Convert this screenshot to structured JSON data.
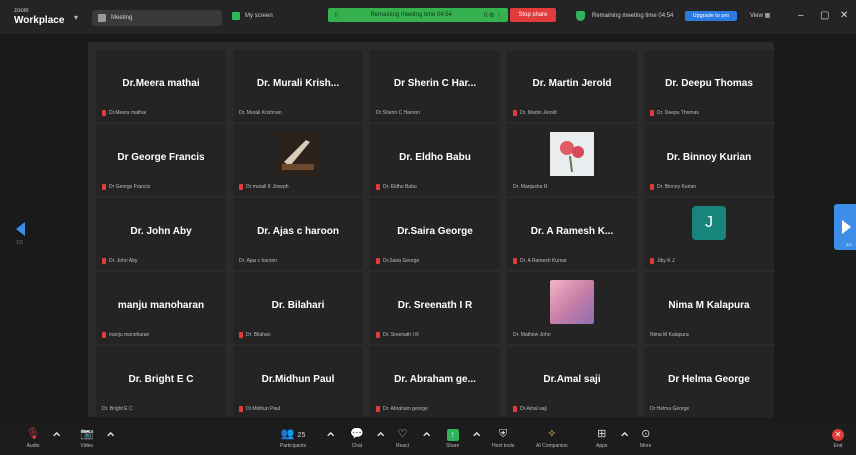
{
  "app": {
    "brand_small": "zoom",
    "brand_big": "Workplace"
  },
  "header": {
    "meeting_tab": "Meeting",
    "my_screen": "My screen",
    "recording_pill": "Remaining meeting time 04:54",
    "pill_controls": "II  ⚙  ⋮",
    "stop_share": "Stop share",
    "remaining_time": "Remaining meeting time 04:54",
    "upgrade": "Upgrade to pro",
    "view": "View ▦",
    "accent": "#35b24f",
    "stop_color": "#e23b3b"
  },
  "participants": [
    {
      "name": "Dr.Meera mathai",
      "sub": "Dr.Meera mathai",
      "muted": true
    },
    {
      "name": "Dr. Murali Krish...",
      "sub": "Dr. Murali Krishnan",
      "muted": false
    },
    {
      "name": "Dr Sherin C Har...",
      "sub": "Dr Sherin C Haroon",
      "muted": false
    },
    {
      "name": "Dr. Martin Jerold",
      "sub": "Dr. Martin Jerold",
      "muted": true
    },
    {
      "name": "Dr. Deepu Thomas",
      "sub": "Dr. Deepu Thomas",
      "muted": true
    },
    {
      "name": "Dr George Francis",
      "sub": "Dr George Francis",
      "muted": true
    },
    {
      "name": "",
      "sub": "Dr murali K Joseph",
      "muted": true,
      "avatar": "photo-pen"
    },
    {
      "name": "Dr. Eldho Babu",
      "sub": "Dr. Eldho Babu",
      "muted": true
    },
    {
      "name": "",
      "sub": "Dr. Manjusha R",
      "muted": false,
      "avatar": "photo-flower"
    },
    {
      "name": "Dr. Binnoy Kurian",
      "sub": "Dr. Binnoy Kurian",
      "muted": true
    },
    {
      "name": "Dr. John Aby",
      "sub": "Dr. John Aby",
      "muted": true
    },
    {
      "name": "Dr. Ajas c haroon",
      "sub": "Dr. Ajas c haroon",
      "muted": false
    },
    {
      "name": "Dr.Saira George",
      "sub": "Dr.Saira George",
      "muted": true
    },
    {
      "name": "Dr. A Ramesh K...",
      "sub": "Dr. A Ramesh Kumar",
      "muted": true
    },
    {
      "name": "",
      "sub": "Jiby K J",
      "muted": true,
      "avatar": "initial",
      "initial": "J"
    },
    {
      "name": "manju manoharan",
      "sub": "manju manoharan",
      "muted": true
    },
    {
      "name": "Dr. Bilahari",
      "sub": "Dr. Bilahari",
      "muted": true
    },
    {
      "name": "Dr. Sreenath I R",
      "sub": "Dr. Sreenath I R",
      "muted": true
    },
    {
      "name": "",
      "sub": "Dr. Mathew John",
      "muted": false,
      "avatar": "photo-sky"
    },
    {
      "name": "Nima M Kalapura",
      "sub": "Nima M Kalapura",
      "muted": false
    },
    {
      "name": "Dr. Bright E C",
      "sub": "Dr. Bright E C",
      "muted": false
    },
    {
      "name": "Dr.Midhun Paul",
      "sub": "Dr.Midhun Paul",
      "muted": true
    },
    {
      "name": "Dr. Abraham ge...",
      "sub": "Dr. Abraham george",
      "muted": true
    },
    {
      "name": "Dr.Amal saji",
      "sub": "Dr.Amal saji",
      "muted": true
    },
    {
      "name": "Dr Helma George",
      "sub": "Dr Helma George",
      "muted": false
    }
  ],
  "nav": {
    "page_left": "1/2",
    "page_right": "2/2"
  },
  "toolbar": {
    "audio": "Audio",
    "video": "Video",
    "participants": "Participants",
    "participants_count": "25",
    "chat": "Chat",
    "react": "React",
    "share": "Share",
    "host_tools": "Host tools",
    "ai_companion": "AI Companion",
    "apps": "Apps",
    "more": "More",
    "end": "End"
  }
}
